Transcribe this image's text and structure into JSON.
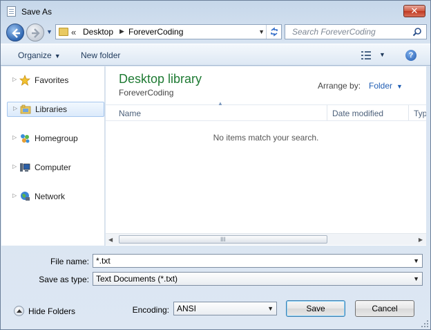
{
  "window": {
    "title": "Save As",
    "close_label": "✕"
  },
  "address_bar": {
    "overflow_chevron": "«",
    "segments": [
      "Desktop",
      "ForeverCoding"
    ],
    "search_placeholder": "Search ForeverCoding"
  },
  "toolbar": {
    "organize_label": "Organize",
    "new_folder_label": "New folder",
    "help_label": "?"
  },
  "nav_pane": {
    "items": [
      {
        "label": "Favorites",
        "icon": "star-icon"
      },
      {
        "label": "Libraries",
        "icon": "libraries-icon",
        "selected": true
      },
      {
        "label": "Homegroup",
        "icon": "homegroup-icon"
      },
      {
        "label": "Computer",
        "icon": "computer-icon"
      },
      {
        "label": "Network",
        "icon": "network-icon"
      }
    ]
  },
  "content": {
    "library_title": "Desktop library",
    "library_subtitle": "ForeverCoding",
    "arrange_by_label": "Arrange by:",
    "arrange_by_value": "Folder",
    "columns": [
      "Name",
      "Date modified",
      "Typ"
    ],
    "empty_message": "No items match your search.",
    "scroll_grip": "III"
  },
  "form": {
    "file_name_label": "File name:",
    "file_name_value": "*.txt",
    "save_as_type_label": "Save as type:",
    "save_as_type_value": "Text Documents (*.txt)"
  },
  "footer": {
    "hide_folders_label": "Hide Folders",
    "encoding_label": "Encoding:",
    "encoding_value": "ANSI",
    "save_label": "Save",
    "cancel_label": "Cancel"
  },
  "colors": {
    "library_title": "#1e7a33",
    "link_blue": "#1e5cb3",
    "selection_border": "#a5c6ef"
  }
}
